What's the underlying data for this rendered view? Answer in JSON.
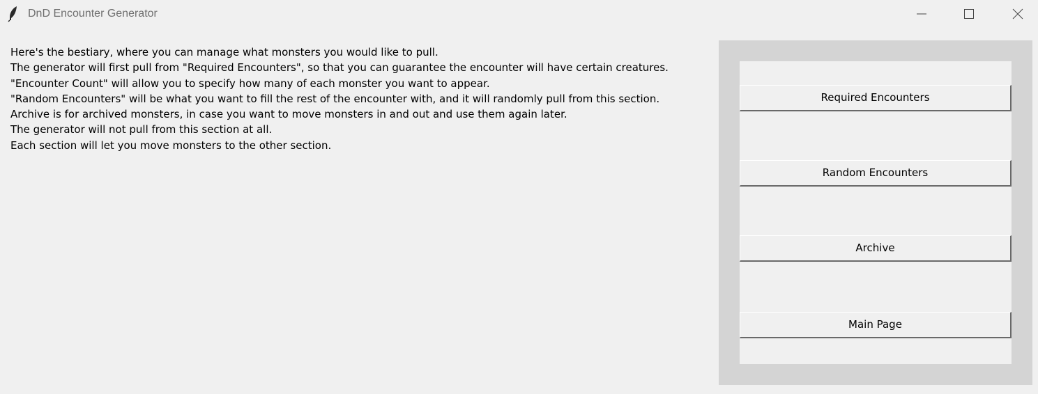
{
  "window": {
    "title": "DnD Encounter Generator",
    "icon": "feather-icon",
    "controls": [
      "minimize-icon",
      "maximize-icon",
      "close-icon"
    ]
  },
  "description": {
    "lines": [
      "Here's the bestiary, where you can manage what monsters you would like to pull.",
      "The generator will first pull from \"Required Encounters\", so that you can guarantee the encounter will have certain creatures.",
      "\"Encounter Count\" will allow you to specify how many of each monster you want to appear.",
      "\"Random Encounters\" will be what you want to fill the rest of the encounter with, and it will randomly pull from this section.",
      "Archive is for archived monsters, in case you want to move monsters in and out and use them again later.",
      "The generator will not pull from this section at all.",
      "Each section will let you move monsters to the other section."
    ]
  },
  "nav": {
    "required_label": "Required Encounters",
    "random_label": "Random Encounters",
    "archive_label": "Archive",
    "main_label": "Main Page"
  },
  "colors": {
    "window_bg": "#f0f0f0",
    "panel_bg": "#d4d4d4",
    "title_text": "#6f6f6f"
  }
}
